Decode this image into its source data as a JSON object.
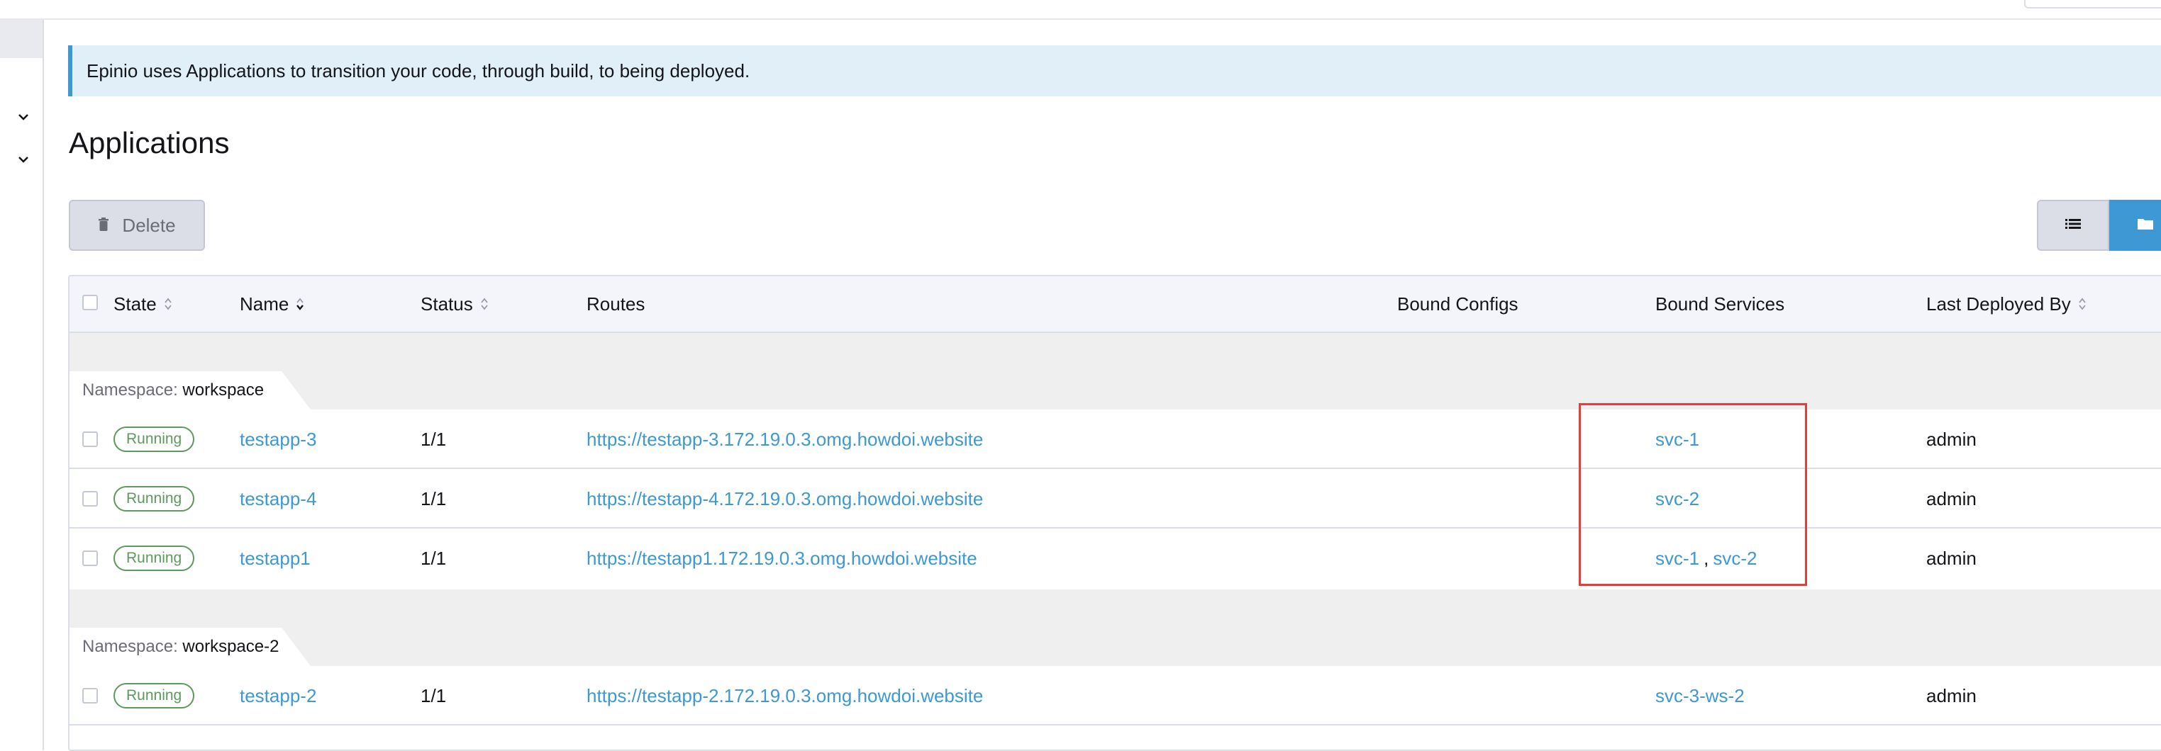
{
  "banner": {
    "text": "Epinio uses Applications to transition your code, through build, to being deployed."
  },
  "page": {
    "title": "Applications"
  },
  "toolbar": {
    "delete_label": "Delete"
  },
  "table": {
    "columns": [
      "State",
      "Name",
      "Status",
      "Routes",
      "Bound Configs",
      "Bound Services",
      "Last Deployed By"
    ],
    "namespace_label": "Namespace:",
    "groups": [
      {
        "namespace": "workspace",
        "rows": [
          {
            "state": "Running",
            "name": "testapp-3",
            "status": "1/1",
            "route": "https://testapp-3.172.19.0.3.omg.howdoi.website",
            "bound_configs": "",
            "bound_services": [
              "svc-1"
            ],
            "last_deployed_by": "admin"
          },
          {
            "state": "Running",
            "name": "testapp-4",
            "status": "1/1",
            "route": "https://testapp-4.172.19.0.3.omg.howdoi.website",
            "bound_configs": "",
            "bound_services": [
              "svc-2"
            ],
            "last_deployed_by": "admin"
          },
          {
            "state": "Running",
            "name": "testapp1",
            "status": "1/1",
            "route": "https://testapp1.172.19.0.3.omg.howdoi.website",
            "bound_configs": "",
            "bound_services": [
              "svc-1",
              "svc-2"
            ],
            "last_deployed_by": "admin"
          }
        ]
      },
      {
        "namespace": "workspace-2",
        "rows": [
          {
            "state": "Running",
            "name": "testapp-2",
            "status": "1/1",
            "route": "https://testapp-2.172.19.0.3.omg.howdoi.website",
            "bound_configs": "",
            "bound_services": [
              "svc-3-ws-2"
            ],
            "last_deployed_by": "admin"
          }
        ]
      }
    ],
    "service_separator": ","
  },
  "colors": {
    "accent": "#3d98d3",
    "running_badge": "#5d995d",
    "highlight_box": "#e0403c",
    "banner_bg": "#e0eff8"
  },
  "icons": {
    "sidebar": [
      "chevron-down-icon",
      "chevron-down-icon"
    ],
    "delete": "trash-icon",
    "view_list": "list-icon",
    "view_group": "folder-icon",
    "sort": "sort-icon"
  }
}
